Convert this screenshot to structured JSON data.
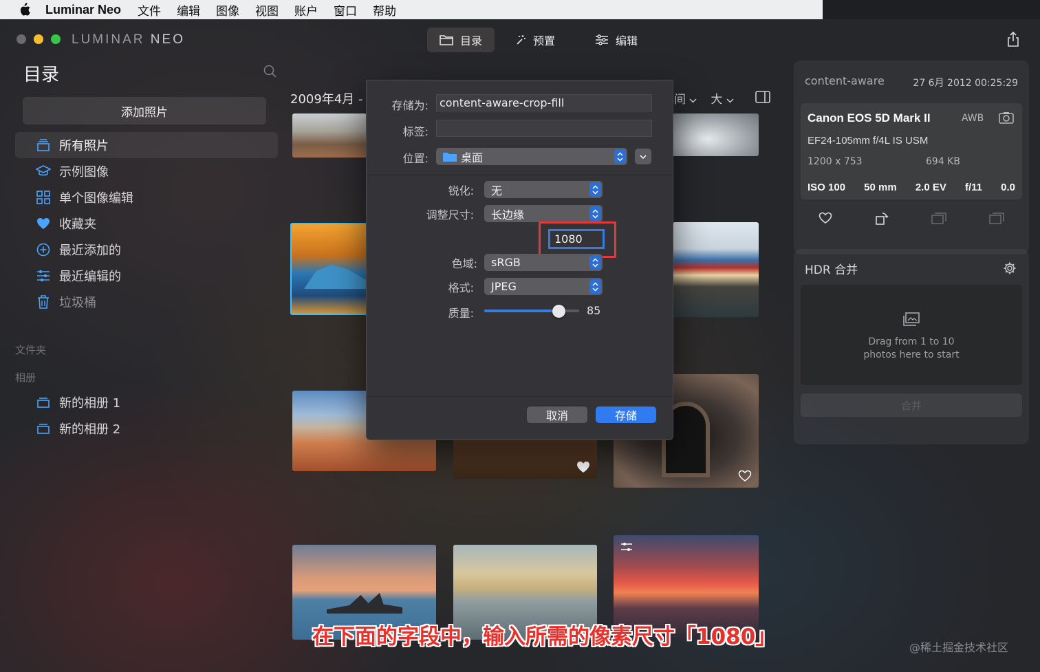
{
  "menubar": {
    "app_name": "Luminar Neo",
    "items": [
      "文件",
      "编辑",
      "图像",
      "视图",
      "账户",
      "窗口",
      "帮助"
    ]
  },
  "window": {
    "logo_left": "LUMINAR",
    "logo_right": "NEO",
    "tabs": [
      {
        "label": "目录",
        "icon": "folder-icon",
        "active": true
      },
      {
        "label": "预置",
        "icon": "magic-wand-icon",
        "active": false
      },
      {
        "label": "编辑",
        "icon": "sliders-icon",
        "active": false
      }
    ]
  },
  "sidebar": {
    "title": "目录",
    "add_photos": "添加照片",
    "items": [
      {
        "label": "所有照片",
        "icon": "photos-stack-icon",
        "active": true
      },
      {
        "label": "示例图像",
        "icon": "graduation-cap-icon",
        "active": false
      },
      {
        "label": "单个图像编辑",
        "icon": "grid-icon",
        "active": false
      },
      {
        "label": "收藏夹",
        "icon": "heart-icon",
        "active": false
      },
      {
        "label": "最近添加的",
        "icon": "plus-circle-icon",
        "active": false
      },
      {
        "label": "最近编辑的",
        "icon": "sliders-icon",
        "active": false
      },
      {
        "label": "垃圾桶",
        "icon": "trash-icon",
        "active": false
      }
    ],
    "folders_label": "文件夹",
    "albums_label": "相册",
    "albums": [
      {
        "label": "新的相册 1",
        "icon": "album-icon"
      },
      {
        "label": "新的相册 2",
        "icon": "album-icon"
      }
    ]
  },
  "grid": {
    "date_header": "2009年4月 -",
    "sort_partial": "间",
    "size_label": "大"
  },
  "info_panel": {
    "filename": "content-aware",
    "date": "27 6月 2012 00:25:29",
    "camera": "Canon EOS 5D Mark II",
    "white_balance": "AWB",
    "lens": "EF24-105mm f/4L IS USM",
    "dimensions": "1200 x 753",
    "file_size": "694 KB",
    "iso": "ISO 100",
    "focal": "50 mm",
    "ev": "2.0 EV",
    "aperture": "f/11",
    "exposure_comp": "0.0"
  },
  "hdr_panel": {
    "title": "HDR 合并",
    "drop_line1": "Drag from 1 to 10",
    "drop_line2": "photos here to start",
    "merge_label": "合并"
  },
  "save_dialog": {
    "save_as_label": "存储为:",
    "save_as_value": "content-aware-crop-fill",
    "tags_label": "标签:",
    "tags_value": "",
    "location_label": "位置:",
    "location_value": "桌面",
    "sharpen_label": "锐化:",
    "sharpen_value": "无",
    "resize_label": "调整尺寸:",
    "resize_value": "长边缘",
    "size_value": "1080",
    "colorspace_label": "色域:",
    "colorspace_value": "sRGB",
    "format_label": "格式:",
    "format_value": "JPEG",
    "quality_label": "质量:",
    "quality_value": "85",
    "quality_fraction": 0.78,
    "cancel_label": "取消",
    "save_label": "存储"
  },
  "overlay": {
    "caption": "在下面的字段中，输入所需的像素尺寸「1080」",
    "watermark": "@稀土掘金技术社区"
  },
  "colors": {
    "accent": "#2f7bef",
    "highlight_box": "#e23a3a",
    "sidebar_icon": "#4aa3ff"
  }
}
